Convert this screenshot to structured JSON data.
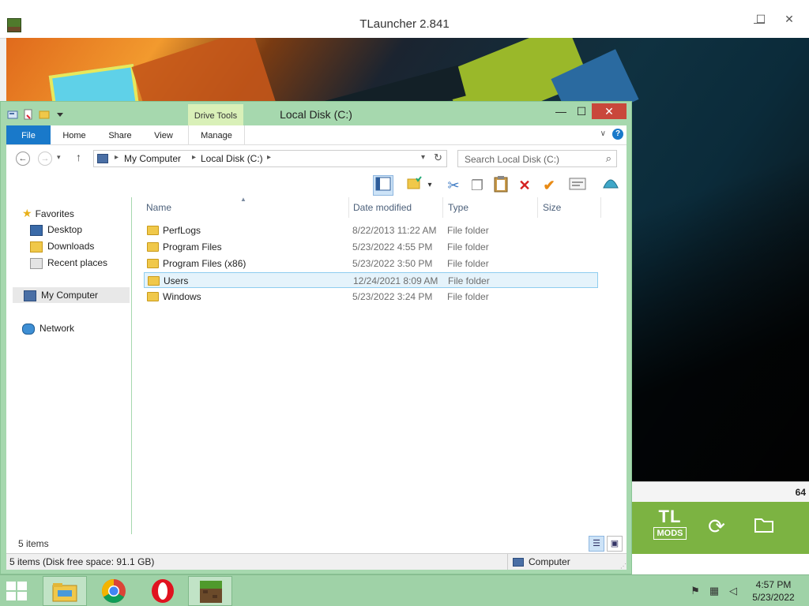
{
  "tlauncher": {
    "title": "TLauncher 2.841",
    "controls": {
      "minimize": "—",
      "maximize": "☐",
      "close": "✕"
    },
    "corner_number": "64",
    "mods_logo": {
      "top": "TL",
      "bottom": "MODS"
    },
    "icons": [
      "refresh-icon",
      "folder-icon"
    ],
    "accent": "#7cb342"
  },
  "explorer": {
    "title": "Local Disk (C:)",
    "controls": {
      "minimize": "—",
      "maximize": "☐",
      "close": "✕"
    },
    "contextual_tab": "Drive Tools",
    "ribbon_tabs": [
      {
        "label": "File"
      },
      {
        "label": "Home"
      },
      {
        "label": "Share"
      },
      {
        "label": "View"
      },
      {
        "label": "Manage"
      }
    ],
    "help": "?",
    "breadcrumb": [
      "My Computer",
      "Local Disk (C:)"
    ],
    "search": {
      "placeholder": "Search Local Disk (C:)"
    },
    "nav": {
      "favorites_label": "Favorites",
      "favorites": [
        "Desktop",
        "Downloads",
        "Recent places"
      ],
      "computer": "My Computer",
      "network": "Network"
    },
    "columns": [
      "Name",
      "Date modified",
      "Type",
      "Size"
    ],
    "files": [
      {
        "name": "PerfLogs",
        "date": "8/22/2013 11:22 AM",
        "type": "File folder"
      },
      {
        "name": "Program Files",
        "date": "5/23/2022 4:55 PM",
        "type": "File folder"
      },
      {
        "name": "Program Files (x86)",
        "date": "5/23/2022 3:50 PM",
        "type": "File folder"
      },
      {
        "name": "Users",
        "date": "12/24/2021 8:09 AM",
        "type": "File folder",
        "selected": true
      },
      {
        "name": "Windows",
        "date": "5/23/2022 3:24 PM",
        "type": "File folder"
      }
    ],
    "item_count": "5 items",
    "status_free": "5 items (Disk free space: 91.1 GB)",
    "status_location": "Computer",
    "accent": "#1979ca",
    "frame_color": "#a6d8ae"
  },
  "taskbar": {
    "apps": [
      "file-explorer",
      "chrome",
      "opera",
      "tlauncher"
    ],
    "time": "4:57 PM",
    "date": "5/23/2022"
  }
}
